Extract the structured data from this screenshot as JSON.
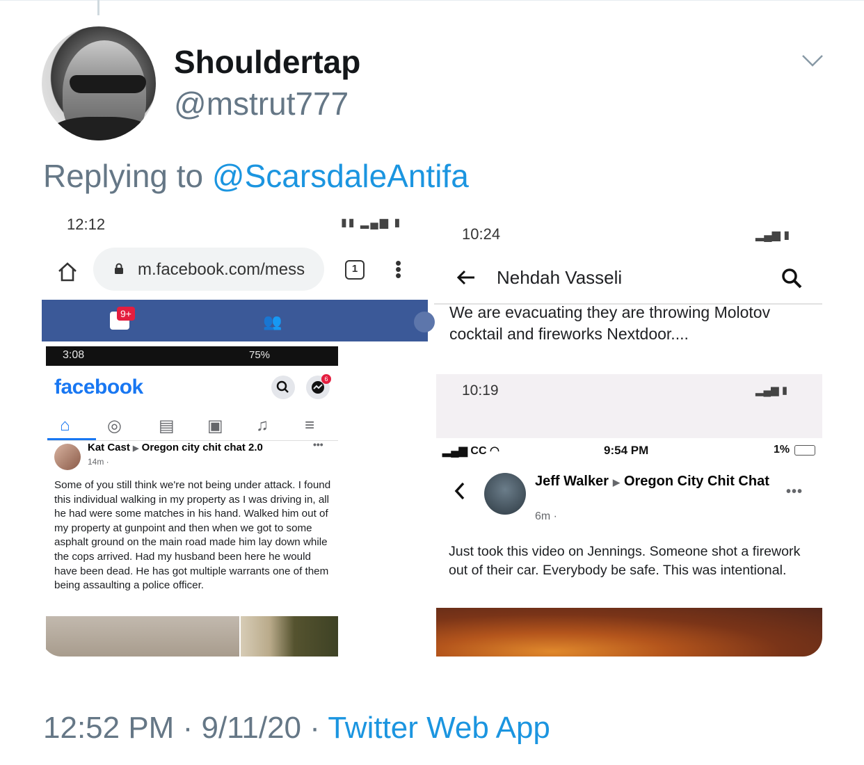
{
  "tweet": {
    "display_name": "Shouldertap",
    "handle": "@mstrut777",
    "replying_prefix": "Replying to",
    "replying_to": "@ScarsdaleAntifa",
    "time": "12:52 PM",
    "separator": "·",
    "date": "9/11/20",
    "source": "Twitter Web App"
  },
  "left_screenshot": {
    "status_time": "12:12",
    "url": "m.facebook.com/mess",
    "tab_count": "1",
    "notification_badge": "9+",
    "inner_status_time": "3:08",
    "inner_battery": "75%",
    "fb_logo": "facebook",
    "messenger_badge": "6",
    "post": {
      "author": "Kat Cast",
      "group": "Oregon city chit chat 2.0",
      "time": "14m ·",
      "body": "Some of you still think we're not being under attack. I found this individual walking in my property as I was driving in, all he had were some matches in his hand. Walked him out of my property at gunpoint and then when we got to some asphalt ground on the main road made him lay down while the cops arrived. Had my husband been here he would have been dead. He has got multiple warrants one of them being assaulting a police officer."
    }
  },
  "right_screenshot": {
    "status_time": "10:24",
    "contact_name": "Nehdah Vasseli",
    "message": "We are evacuating they are throwing Molotov cocktail and fireworks Nextdoor....",
    "inner_status_time": "10:19",
    "ios": {
      "carrier": "CC",
      "time": "9:54 PM",
      "battery": "1%"
    },
    "post": {
      "author": "Jeff Walker",
      "group": "Oregon City Chit Chat",
      "time": "6m ·",
      "more": "•••",
      "body": "Just took this video on Jennings. Someone shot a firework out of their car. Everybody be safe. This was intentional."
    }
  },
  "icons": [
    "chevron-down-icon",
    "home-icon",
    "lock-icon",
    "tabs-icon",
    "kebab-menu-icon",
    "back-arrow-icon",
    "search-icon",
    "messenger-icon"
  ],
  "colors": {
    "link_blue": "#1b95e0",
    "muted_gray": "#657786",
    "facebook_blue": "#3b5998",
    "facebook_logo": "#1877f2"
  }
}
